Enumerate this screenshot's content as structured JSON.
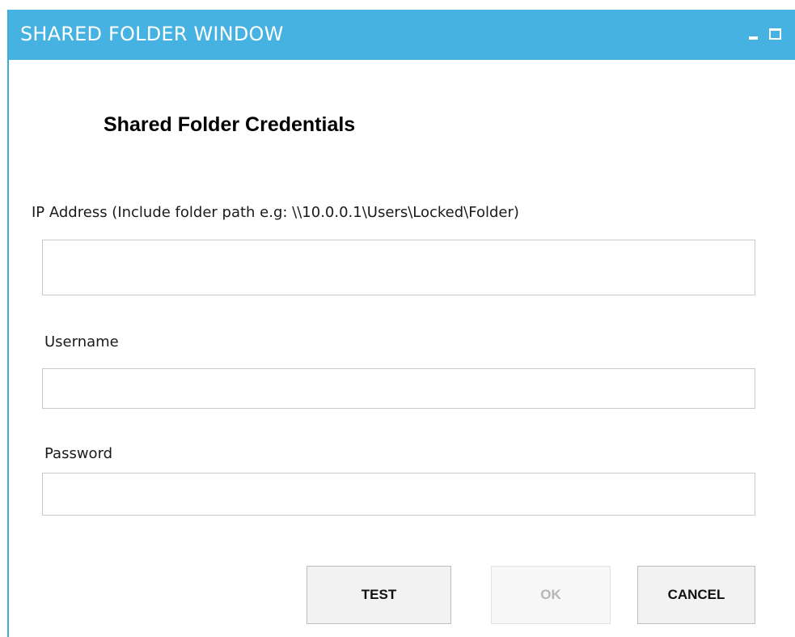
{
  "window": {
    "title": "SHARED FOLDER WINDOW",
    "titlebar_color": "#45b2e2"
  },
  "form": {
    "heading": "Shared Folder Credentials",
    "ip_address": {
      "label": "IP Address (Include folder path e.g: \\\\10.0.0.1\\Users\\Locked\\Folder)",
      "value": "",
      "placeholder": ""
    },
    "username": {
      "label": "Username",
      "value": "",
      "placeholder": ""
    },
    "password": {
      "label": "Password",
      "value": "",
      "placeholder": ""
    }
  },
  "buttons": {
    "test_label": "TEST",
    "ok_label": "OK",
    "cancel_label": "CANCEL"
  },
  "icons": {
    "minimize": "minimize-icon",
    "maximize": "maximize-icon"
  }
}
